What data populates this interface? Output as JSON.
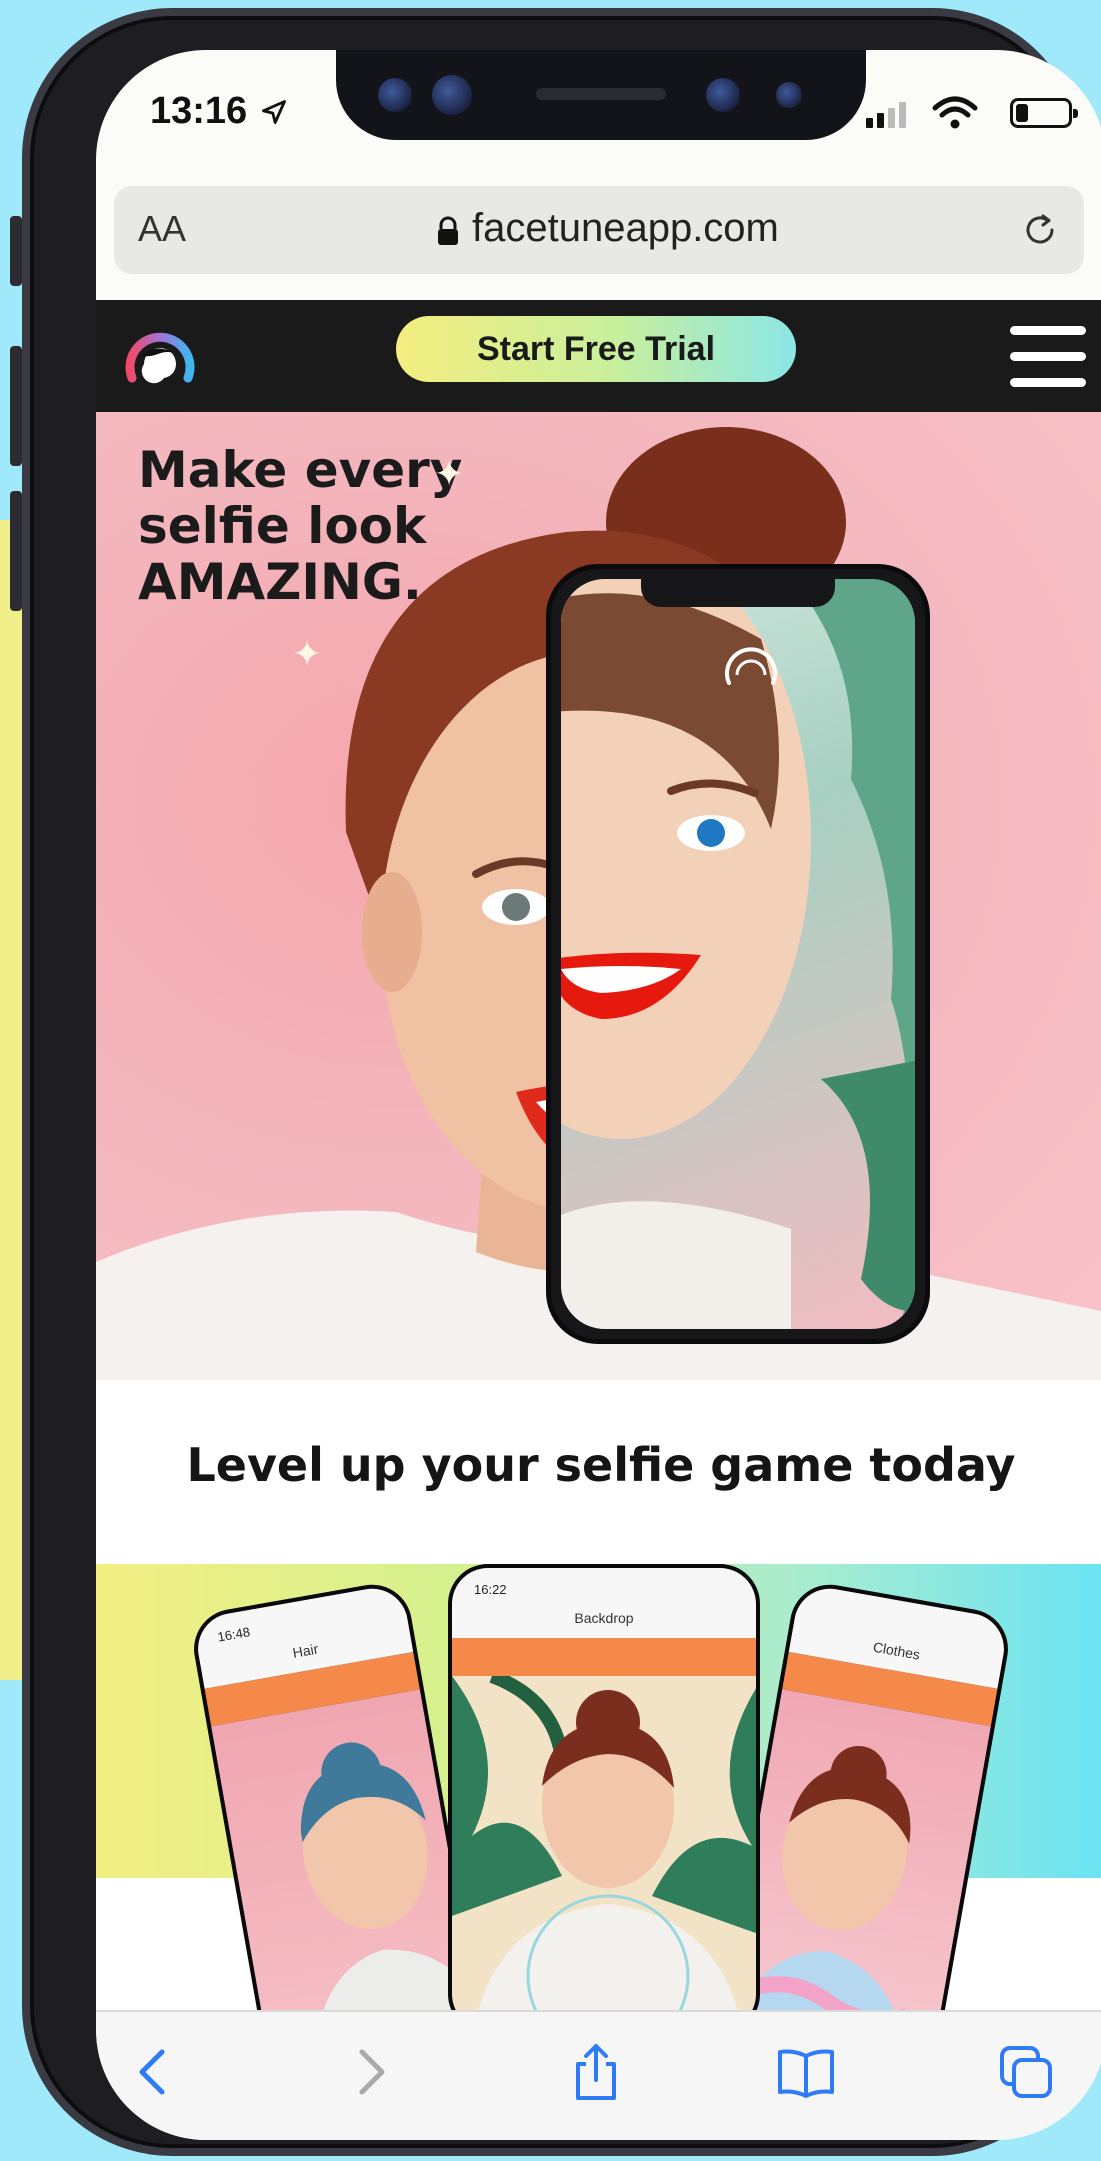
{
  "status_bar": {
    "time": "13:16"
  },
  "browser": {
    "text_size_label": "AA",
    "url": "facetuneapp.com"
  },
  "site_header": {
    "cta_label": "Start Free Trial"
  },
  "hero": {
    "headline": "Make every\nselfie look\nAMAZING."
  },
  "section": {
    "title": "Level up your selfie game today"
  },
  "showcase": {
    "phones": [
      {
        "time": "16:48",
        "label": "Hair"
      },
      {
        "time": "16:22",
        "label": "Backdrop"
      },
      {
        "time": "",
        "label": "Clothes"
      }
    ]
  },
  "colors": {
    "page_background": "#9fe9fb",
    "header_background": "#1a1a1a",
    "cta_gradient_start": "#f4ee7f",
    "cta_gradient_end": "#8be6e6",
    "hero_background": "#f3b6bd",
    "toolbar_accent": "#2f7bf5"
  },
  "toolbar": {
    "icons": [
      "back-icon",
      "forward-icon",
      "share-icon",
      "bookmarks-icon",
      "tabs-icon"
    ]
  }
}
